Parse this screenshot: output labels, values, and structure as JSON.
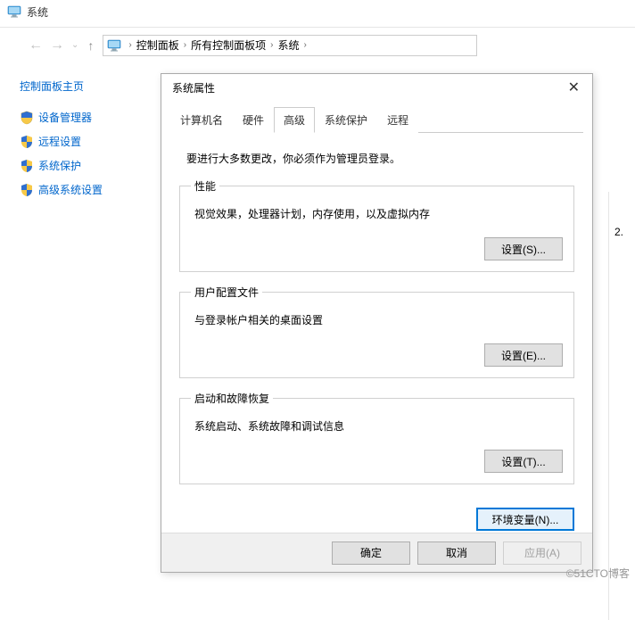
{
  "window": {
    "title": "系统"
  },
  "breadcrumb": {
    "items": [
      "控制面板",
      "所有控制面板项",
      "系统"
    ]
  },
  "sidebar": {
    "home": "控制面板主页",
    "links": [
      "设备管理器",
      "远程设置",
      "系统保护",
      "高级系统设置"
    ]
  },
  "right_strip": {
    "text": "2."
  },
  "dialog": {
    "title": "系统属性",
    "tabs": [
      "计算机名",
      "硬件",
      "高级",
      "系统保护",
      "远程"
    ],
    "active_tab_index": 2,
    "admin_note": "要进行大多数更改，你必须作为管理员登录。",
    "groups": [
      {
        "legend": "性能",
        "desc": "视觉效果，处理器计划，内存使用，以及虚拟内存",
        "button": "设置(S)..."
      },
      {
        "legend": "用户配置文件",
        "desc": "与登录帐户相关的桌面设置",
        "button": "设置(E)..."
      },
      {
        "legend": "启动和故障恢复",
        "desc": "系统启动、系统故障和调试信息",
        "button": "设置(T)..."
      }
    ],
    "env_button": "环境变量(N)...",
    "footer": {
      "ok": "确定",
      "cancel": "取消",
      "apply": "应用(A)"
    }
  },
  "watermark": "©51CTO博客"
}
